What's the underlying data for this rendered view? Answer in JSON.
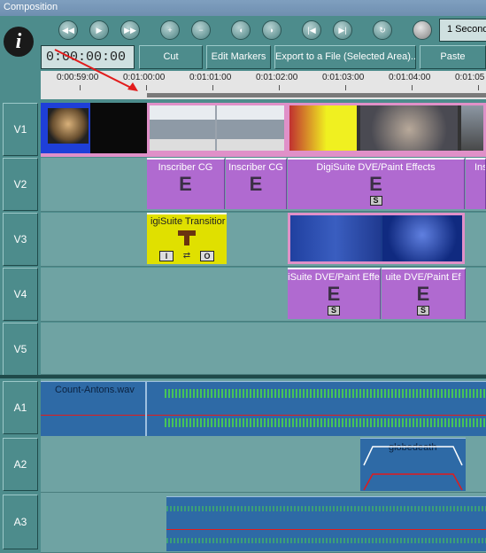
{
  "window": {
    "title": "Composition"
  },
  "logo": {
    "glyph": "i"
  },
  "transport": {
    "buttons": [
      "rewind-icon",
      "play-icon",
      "fast-forward-icon",
      "zoom-in-icon",
      "zoom-out-icon",
      "mark-in-icon",
      "mark-out-icon",
      "go-to-start-icon",
      "go-to-end-icon",
      "refresh-icon",
      "record-icon"
    ],
    "duration_label": "1 Second"
  },
  "toolbar": {
    "timecode": "0:00:00:00",
    "cut_label": "Cut",
    "edit_markers_label": "Edit Markers",
    "export_label": "Export to a File (Selected Area)..",
    "paste_label": "Paste"
  },
  "ruler": {
    "ticks": [
      "0:00:59:00",
      "0:01:00:00",
      "0:01:01:00",
      "0:01:02:00",
      "0:01:03:00",
      "0:01:04:00",
      "0:01:05"
    ]
  },
  "tracks": {
    "video": [
      "V1",
      "V2",
      "V3",
      "V4",
      "V5"
    ],
    "audio": [
      "A1",
      "A2",
      "A3"
    ]
  },
  "clips": {
    "v2": [
      {
        "label": "Inscriber CG",
        "icon": "effect-icon"
      },
      {
        "label": "Inscriber CG",
        "icon": "effect-icon"
      },
      {
        "label": "DigiSuite DVE/Paint Effects",
        "icon": "effect-icon",
        "badge": "S"
      },
      {
        "label": "Ins",
        "icon": "effect-icon"
      }
    ],
    "v3_transition": {
      "label": "igiSuite Transitior",
      "in": "I",
      "out": "O"
    },
    "v4": [
      {
        "label": "iSuite DVE/Paint Effe",
        "icon": "effect-icon",
        "badge": "S"
      },
      {
        "label": "uite DVE/Paint Ef",
        "icon": "effect-icon",
        "badge": "S"
      }
    ],
    "a1": {
      "label": "Count-Antons.wav"
    },
    "a2": {
      "label": "globedeath"
    }
  },
  "colors": {
    "lane": "#6fa3a3",
    "fx": "#b06ad0",
    "audio": "#2e6aa6",
    "wave": "#4bd44b",
    "transition": "#e0e000"
  }
}
